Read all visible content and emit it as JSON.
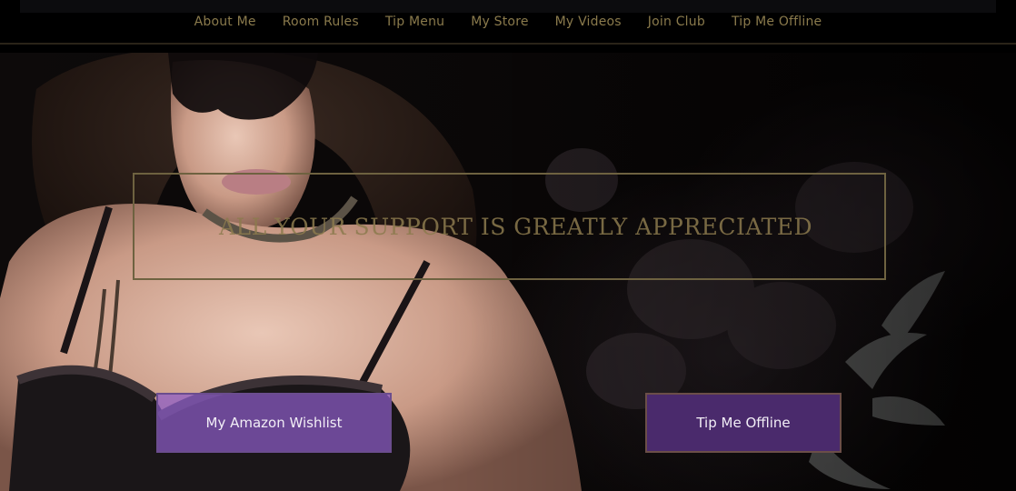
{
  "nav": {
    "items": [
      {
        "label": "About Me"
      },
      {
        "label": "Room Rules"
      },
      {
        "label": "Tip Menu"
      },
      {
        "label": "My Store"
      },
      {
        "label": "My Videos"
      },
      {
        "label": "Join Club"
      },
      {
        "label": "Tip Me Offline"
      }
    ]
  },
  "hero": {
    "quote": "All your support is greatly appreciated",
    "buttons": {
      "wishlist_label": "My Amazon Wishlist",
      "offline_label": "Tip Me Offline"
    }
  },
  "colors": {
    "nav_text": "#8a7a4c",
    "frame_gold": "#6e6240",
    "wishlist_purple": "#8c5cc8",
    "offline_purple": "#4a2a6c"
  }
}
